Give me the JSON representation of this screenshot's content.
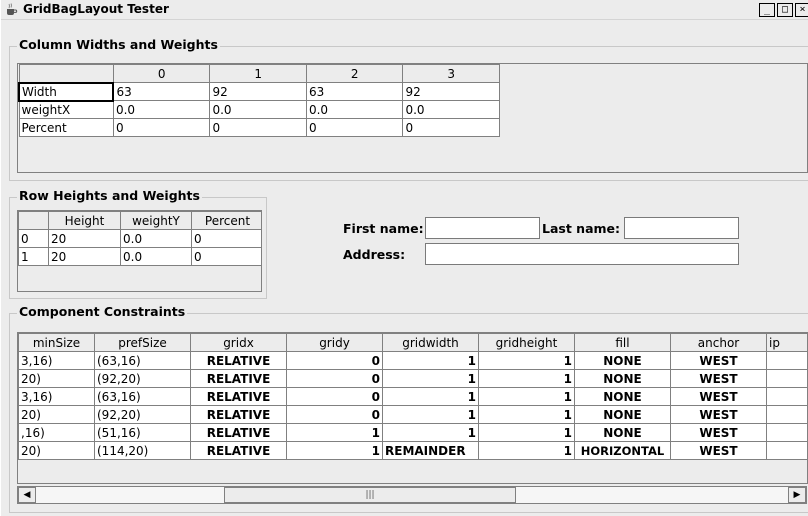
{
  "window": {
    "title": "GridBagLayout Tester",
    "minimize_glyph": "_",
    "maximize_glyph": "□",
    "close_glyph": "×"
  },
  "columns_panel": {
    "title": "Column Widths and Weights",
    "headers": [
      "",
      "0",
      "1",
      "2",
      "3"
    ],
    "rows": [
      [
        "Width",
        "63",
        "92",
        "63",
        "92"
      ],
      [
        "weightX",
        "0.0",
        "0.0",
        "0.0",
        "0.0"
      ],
      [
        "Percent",
        "0",
        "0",
        "0",
        "0"
      ]
    ]
  },
  "rows_panel": {
    "title": "Row Heights and Weights",
    "headers": [
      "",
      "Height",
      "weightY",
      "Percent"
    ],
    "rows": [
      [
        "0",
        "20",
        "0.0",
        "0"
      ],
      [
        "1",
        "20",
        "0.0",
        "0"
      ]
    ]
  },
  "form": {
    "first_name_label": "First name:",
    "last_name_label": "Last name:",
    "address_label": "Address:",
    "first_name_value": "",
    "last_name_value": "",
    "address_value": ""
  },
  "constraints_panel": {
    "title": "Component Constraints",
    "headers": [
      "minSize",
      "prefSize",
      "gridx",
      "gridy",
      "gridwidth",
      "gridheight",
      "fill",
      "anchor",
      "ip"
    ],
    "rows": [
      [
        "3,16)",
        "(63,16)",
        "RELATIVE",
        "0",
        "1",
        "1",
        "NONE",
        "WEST",
        ""
      ],
      [
        "20)",
        "(92,20)",
        "RELATIVE",
        "0",
        "1",
        "1",
        "NONE",
        "WEST",
        ""
      ],
      [
        "3,16)",
        "(63,16)",
        "RELATIVE",
        "0",
        "1",
        "1",
        "NONE",
        "WEST",
        ""
      ],
      [
        "20)",
        "(92,20)",
        "RELATIVE",
        "0",
        "1",
        "1",
        "NONE",
        "WEST",
        ""
      ],
      [
        ",16)",
        "(51,16)",
        "RELATIVE",
        "1",
        "1",
        "1",
        "NONE",
        "WEST",
        ""
      ],
      [
        "20)",
        "(114,20)",
        "RELATIVE",
        "1",
        "REMAINDER",
        "1",
        "HORIZONTAL",
        "WEST",
        ""
      ]
    ]
  },
  "scrollbar": {
    "left_arrow": "◀",
    "right_arrow": "▶",
    "thumb_grip": "|||"
  }
}
